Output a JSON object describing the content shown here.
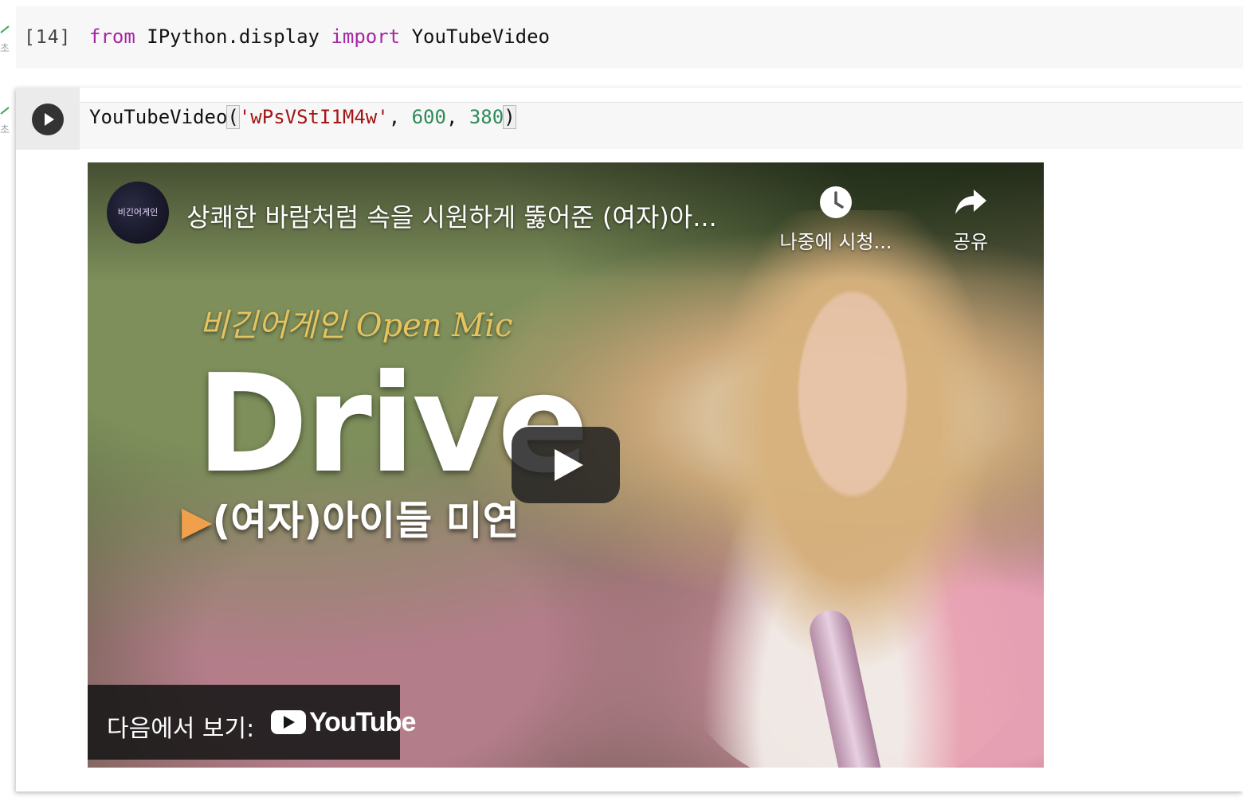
{
  "cell1": {
    "exec_count": "[14]",
    "status_secs": "초",
    "code": {
      "kw_from": "from",
      "module": "IPython.display",
      "kw_import": "import",
      "name": "YouTubeVideo"
    }
  },
  "cell2": {
    "status_secs": "초",
    "code": {
      "func": "YouTubeVideo",
      "paren_open": "(",
      "arg1": "'wPsVStI1M4w'",
      "sep1": ", ",
      "arg2": "600",
      "sep2": ", ",
      "arg3": "380",
      "paren_close": ")"
    }
  },
  "video": {
    "channel_avatar_text": "비긴어게인",
    "title": "상쾌한 바람처럼 속을 시원하게 뚫어준 (여자)아...",
    "watch_later_label": "나중에 시청...",
    "share_label": "공유",
    "overlay_brand": "비긴어게인 Open Mic",
    "overlay_song": "Drive",
    "overlay_artist_marker": "▶",
    "overlay_artist": "(여자)아이들 미연",
    "watch_on_label": "다음에서 보기:",
    "youtube_word": "YouTube"
  }
}
